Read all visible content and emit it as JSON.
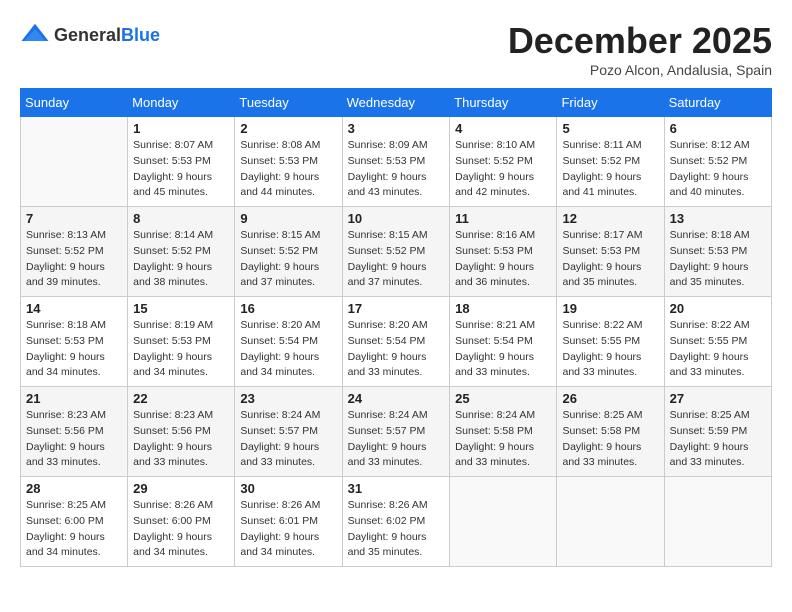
{
  "logo": {
    "text_general": "General",
    "text_blue": "Blue"
  },
  "header": {
    "month": "December 2025",
    "location": "Pozo Alcon, Andalusia, Spain"
  },
  "days_of_week": [
    "Sunday",
    "Monday",
    "Tuesday",
    "Wednesday",
    "Thursday",
    "Friday",
    "Saturday"
  ],
  "weeks": [
    {
      "shaded": false,
      "days": [
        {
          "num": "",
          "sunrise": "",
          "sunset": "",
          "daylight": ""
        },
        {
          "num": "1",
          "sunrise": "Sunrise: 8:07 AM",
          "sunset": "Sunset: 5:53 PM",
          "daylight": "Daylight: 9 hours and 45 minutes."
        },
        {
          "num": "2",
          "sunrise": "Sunrise: 8:08 AM",
          "sunset": "Sunset: 5:53 PM",
          "daylight": "Daylight: 9 hours and 44 minutes."
        },
        {
          "num": "3",
          "sunrise": "Sunrise: 8:09 AM",
          "sunset": "Sunset: 5:53 PM",
          "daylight": "Daylight: 9 hours and 43 minutes."
        },
        {
          "num": "4",
          "sunrise": "Sunrise: 8:10 AM",
          "sunset": "Sunset: 5:52 PM",
          "daylight": "Daylight: 9 hours and 42 minutes."
        },
        {
          "num": "5",
          "sunrise": "Sunrise: 8:11 AM",
          "sunset": "Sunset: 5:52 PM",
          "daylight": "Daylight: 9 hours and 41 minutes."
        },
        {
          "num": "6",
          "sunrise": "Sunrise: 8:12 AM",
          "sunset": "Sunset: 5:52 PM",
          "daylight": "Daylight: 9 hours and 40 minutes."
        }
      ]
    },
    {
      "shaded": true,
      "days": [
        {
          "num": "7",
          "sunrise": "Sunrise: 8:13 AM",
          "sunset": "Sunset: 5:52 PM",
          "daylight": "Daylight: 9 hours and 39 minutes."
        },
        {
          "num": "8",
          "sunrise": "Sunrise: 8:14 AM",
          "sunset": "Sunset: 5:52 PM",
          "daylight": "Daylight: 9 hours and 38 minutes."
        },
        {
          "num": "9",
          "sunrise": "Sunrise: 8:15 AM",
          "sunset": "Sunset: 5:52 PM",
          "daylight": "Daylight: 9 hours and 37 minutes."
        },
        {
          "num": "10",
          "sunrise": "Sunrise: 8:15 AM",
          "sunset": "Sunset: 5:52 PM",
          "daylight": "Daylight: 9 hours and 37 minutes."
        },
        {
          "num": "11",
          "sunrise": "Sunrise: 8:16 AM",
          "sunset": "Sunset: 5:53 PM",
          "daylight": "Daylight: 9 hours and 36 minutes."
        },
        {
          "num": "12",
          "sunrise": "Sunrise: 8:17 AM",
          "sunset": "Sunset: 5:53 PM",
          "daylight": "Daylight: 9 hours and 35 minutes."
        },
        {
          "num": "13",
          "sunrise": "Sunrise: 8:18 AM",
          "sunset": "Sunset: 5:53 PM",
          "daylight": "Daylight: 9 hours and 35 minutes."
        }
      ]
    },
    {
      "shaded": false,
      "days": [
        {
          "num": "14",
          "sunrise": "Sunrise: 8:18 AM",
          "sunset": "Sunset: 5:53 PM",
          "daylight": "Daylight: 9 hours and 34 minutes."
        },
        {
          "num": "15",
          "sunrise": "Sunrise: 8:19 AM",
          "sunset": "Sunset: 5:53 PM",
          "daylight": "Daylight: 9 hours and 34 minutes."
        },
        {
          "num": "16",
          "sunrise": "Sunrise: 8:20 AM",
          "sunset": "Sunset: 5:54 PM",
          "daylight": "Daylight: 9 hours and 34 minutes."
        },
        {
          "num": "17",
          "sunrise": "Sunrise: 8:20 AM",
          "sunset": "Sunset: 5:54 PM",
          "daylight": "Daylight: 9 hours and 33 minutes."
        },
        {
          "num": "18",
          "sunrise": "Sunrise: 8:21 AM",
          "sunset": "Sunset: 5:54 PM",
          "daylight": "Daylight: 9 hours and 33 minutes."
        },
        {
          "num": "19",
          "sunrise": "Sunrise: 8:22 AM",
          "sunset": "Sunset: 5:55 PM",
          "daylight": "Daylight: 9 hours and 33 minutes."
        },
        {
          "num": "20",
          "sunrise": "Sunrise: 8:22 AM",
          "sunset": "Sunset: 5:55 PM",
          "daylight": "Daylight: 9 hours and 33 minutes."
        }
      ]
    },
    {
      "shaded": true,
      "days": [
        {
          "num": "21",
          "sunrise": "Sunrise: 8:23 AM",
          "sunset": "Sunset: 5:56 PM",
          "daylight": "Daylight: 9 hours and 33 minutes."
        },
        {
          "num": "22",
          "sunrise": "Sunrise: 8:23 AM",
          "sunset": "Sunset: 5:56 PM",
          "daylight": "Daylight: 9 hours and 33 minutes."
        },
        {
          "num": "23",
          "sunrise": "Sunrise: 8:24 AM",
          "sunset": "Sunset: 5:57 PM",
          "daylight": "Daylight: 9 hours and 33 minutes."
        },
        {
          "num": "24",
          "sunrise": "Sunrise: 8:24 AM",
          "sunset": "Sunset: 5:57 PM",
          "daylight": "Daylight: 9 hours and 33 minutes."
        },
        {
          "num": "25",
          "sunrise": "Sunrise: 8:24 AM",
          "sunset": "Sunset: 5:58 PM",
          "daylight": "Daylight: 9 hours and 33 minutes."
        },
        {
          "num": "26",
          "sunrise": "Sunrise: 8:25 AM",
          "sunset": "Sunset: 5:58 PM",
          "daylight": "Daylight: 9 hours and 33 minutes."
        },
        {
          "num": "27",
          "sunrise": "Sunrise: 8:25 AM",
          "sunset": "Sunset: 5:59 PM",
          "daylight": "Daylight: 9 hours and 33 minutes."
        }
      ]
    },
    {
      "shaded": false,
      "days": [
        {
          "num": "28",
          "sunrise": "Sunrise: 8:25 AM",
          "sunset": "Sunset: 6:00 PM",
          "daylight": "Daylight: 9 hours and 34 minutes."
        },
        {
          "num": "29",
          "sunrise": "Sunrise: 8:26 AM",
          "sunset": "Sunset: 6:00 PM",
          "daylight": "Daylight: 9 hours and 34 minutes."
        },
        {
          "num": "30",
          "sunrise": "Sunrise: 8:26 AM",
          "sunset": "Sunset: 6:01 PM",
          "daylight": "Daylight: 9 hours and 34 minutes."
        },
        {
          "num": "31",
          "sunrise": "Sunrise: 8:26 AM",
          "sunset": "Sunset: 6:02 PM",
          "daylight": "Daylight: 9 hours and 35 minutes."
        },
        {
          "num": "",
          "sunrise": "",
          "sunset": "",
          "daylight": ""
        },
        {
          "num": "",
          "sunrise": "",
          "sunset": "",
          "daylight": ""
        },
        {
          "num": "",
          "sunrise": "",
          "sunset": "",
          "daylight": ""
        }
      ]
    }
  ]
}
